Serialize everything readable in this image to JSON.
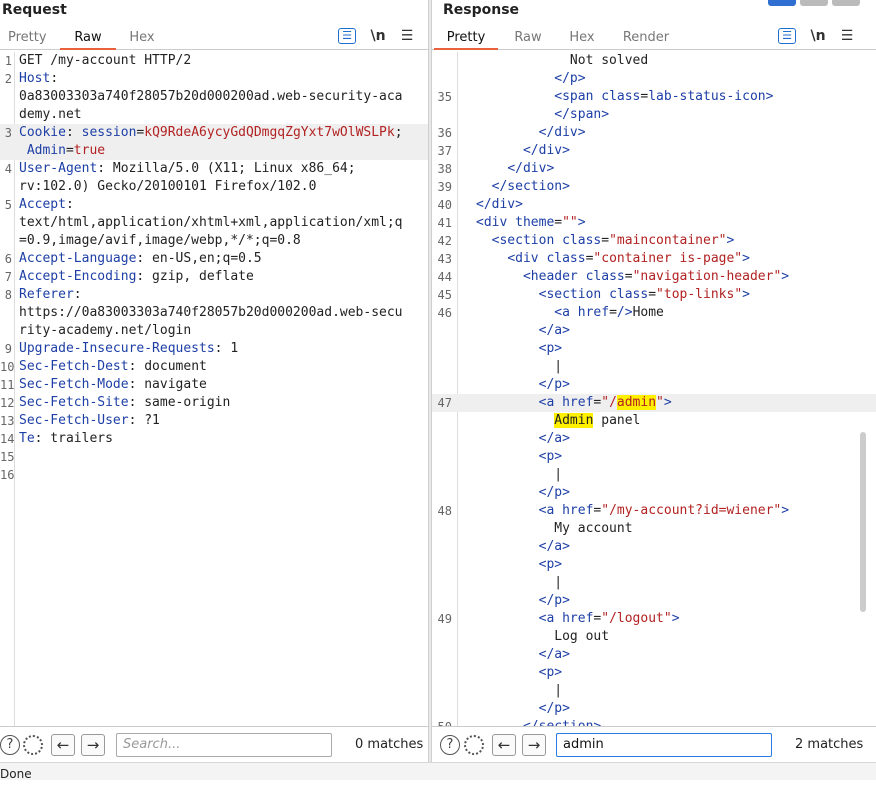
{
  "request": {
    "title": "Request",
    "tabs": [
      "Pretty",
      "Raw",
      "Hex"
    ],
    "active_tab": "Raw",
    "toolbar": {
      "wrap_icon": "word-wrap-icon",
      "newline_label": "\\n",
      "menu_icon": "hamburger-menu-icon"
    },
    "lines": [
      {
        "n": "1",
        "parts": [
          {
            "c": "",
            "t": "GET /my-account HTTP/2"
          }
        ]
      },
      {
        "n": "2",
        "parts": [
          {
            "c": "k",
            "t": "Host"
          },
          {
            "c": "",
            "t": ":"
          }
        ]
      },
      {
        "n": "",
        "parts": [
          {
            "c": "",
            "t": "0a83003303a740f28057b20d000200ad.web-security-aca"
          }
        ]
      },
      {
        "n": "",
        "parts": [
          {
            "c": "",
            "t": "demy.net"
          }
        ]
      },
      {
        "n": "3",
        "hl": true,
        "parts": [
          {
            "c": "k",
            "t": "Cookie"
          },
          {
            "c": "",
            "t": ": "
          },
          {
            "c": "k",
            "t": "session"
          },
          {
            "c": "",
            "t": "="
          },
          {
            "c": "v",
            "t": "kQ9RdeA6ycyGdQDmgqZgYxt7wOlWSLPk"
          },
          {
            "c": "",
            "t": ";"
          }
        ]
      },
      {
        "n": "",
        "hl": true,
        "parts": [
          {
            "c": "",
            "t": " "
          },
          {
            "c": "k",
            "t": "Admin"
          },
          {
            "c": "",
            "t": "="
          },
          {
            "c": "v",
            "t": "true"
          }
        ]
      },
      {
        "n": "4",
        "parts": [
          {
            "c": "k",
            "t": "User-Agent"
          },
          {
            "c": "",
            "t": ": Mozilla/5.0 (X11; Linux x86_64;"
          }
        ]
      },
      {
        "n": "",
        "parts": [
          {
            "c": "",
            "t": "rv:102.0) Gecko/20100101 Firefox/102.0"
          }
        ]
      },
      {
        "n": "5",
        "parts": [
          {
            "c": "k",
            "t": "Accept"
          },
          {
            "c": "",
            "t": ":"
          }
        ]
      },
      {
        "n": "",
        "parts": [
          {
            "c": "",
            "t": "text/html,application/xhtml+xml,application/xml;q"
          }
        ]
      },
      {
        "n": "",
        "parts": [
          {
            "c": "",
            "t": "=0.9,image/avif,image/webp,*/*;q=0.8"
          }
        ]
      },
      {
        "n": "6",
        "parts": [
          {
            "c": "k",
            "t": "Accept-Language"
          },
          {
            "c": "",
            "t": ": en-US,en;q=0.5"
          }
        ]
      },
      {
        "n": "7",
        "parts": [
          {
            "c": "k",
            "t": "Accept-Encoding"
          },
          {
            "c": "",
            "t": ": gzip, deflate"
          }
        ]
      },
      {
        "n": "8",
        "parts": [
          {
            "c": "k",
            "t": "Referer"
          },
          {
            "c": "",
            "t": ":"
          }
        ]
      },
      {
        "n": "",
        "parts": [
          {
            "c": "",
            "t": "https://0a83003303a740f28057b20d000200ad.web-secu"
          }
        ]
      },
      {
        "n": "",
        "parts": [
          {
            "c": "",
            "t": "rity-academy.net/login"
          }
        ]
      },
      {
        "n": "9",
        "parts": [
          {
            "c": "k",
            "t": "Upgrade-Insecure-Requests"
          },
          {
            "c": "",
            "t": ": 1"
          }
        ]
      },
      {
        "n": "10",
        "parts": [
          {
            "c": "k",
            "t": "Sec-Fetch-Dest"
          },
          {
            "c": "",
            "t": ": document"
          }
        ]
      },
      {
        "n": "11",
        "parts": [
          {
            "c": "k",
            "t": "Sec-Fetch-Mode"
          },
          {
            "c": "",
            "t": ": navigate"
          }
        ]
      },
      {
        "n": "12",
        "parts": [
          {
            "c": "k",
            "t": "Sec-Fetch-Site"
          },
          {
            "c": "",
            "t": ": same-origin"
          }
        ]
      },
      {
        "n": "13",
        "parts": [
          {
            "c": "k",
            "t": "Sec-Fetch-User"
          },
          {
            "c": "",
            "t": ": ?1"
          }
        ]
      },
      {
        "n": "14",
        "parts": [
          {
            "c": "k",
            "t": "Te"
          },
          {
            "c": "",
            "t": ": trailers"
          }
        ]
      },
      {
        "n": "15",
        "parts": []
      },
      {
        "n": "16",
        "parts": []
      }
    ],
    "search": {
      "placeholder": "Search...",
      "value": "",
      "matches": "0 matches"
    }
  },
  "response": {
    "title": "Response",
    "tabs": [
      "Pretty",
      "Raw",
      "Hex",
      "Render"
    ],
    "active_tab": "Pretty",
    "toolbar": {
      "wrap_icon": "word-wrap-icon",
      "newline_label": "\\n",
      "menu_icon": "hamburger-menu-icon"
    },
    "lines": [
      {
        "n": "",
        "parts": [
          {
            "c": "",
            "t": "            Not solved"
          }
        ]
      },
      {
        "n": "",
        "parts": [
          {
            "c": "",
            "t": "          "
          },
          {
            "c": "t",
            "t": "</p>"
          }
        ]
      },
      {
        "n": "35",
        "parts": [
          {
            "c": "",
            "t": "          "
          },
          {
            "c": "t",
            "t": "<span "
          },
          {
            "c": "a",
            "t": "class"
          },
          {
            "c": "",
            "t": "="
          },
          {
            "c": "t",
            "t": "lab-status-icon"
          },
          {
            "c": "t",
            "t": ">"
          }
        ]
      },
      {
        "n": "",
        "parts": [
          {
            "c": "",
            "t": "          "
          },
          {
            "c": "t",
            "t": "</span>"
          }
        ]
      },
      {
        "n": "36",
        "parts": [
          {
            "c": "",
            "t": "        "
          },
          {
            "c": "t",
            "t": "</div>"
          }
        ]
      },
      {
        "n": "37",
        "parts": [
          {
            "c": "",
            "t": "      "
          },
          {
            "c": "t",
            "t": "</div>"
          }
        ]
      },
      {
        "n": "38",
        "parts": [
          {
            "c": "",
            "t": "    "
          },
          {
            "c": "t",
            "t": "</div>"
          }
        ]
      },
      {
        "n": "39",
        "parts": [
          {
            "c": "",
            "t": "  "
          },
          {
            "c": "t",
            "t": "</section>"
          }
        ]
      },
      {
        "n": "40",
        "parts": [
          {
            "c": "t",
            "t": "</div>"
          }
        ]
      },
      {
        "n": "41",
        "parts": [
          {
            "c": "t",
            "t": "<div "
          },
          {
            "c": "a",
            "t": "theme"
          },
          {
            "c": "",
            "t": "="
          },
          {
            "c": "s",
            "t": "\"\""
          },
          {
            "c": "t",
            "t": ">"
          }
        ]
      },
      {
        "n": "42",
        "parts": [
          {
            "c": "",
            "t": "  "
          },
          {
            "c": "t",
            "t": "<section "
          },
          {
            "c": "a",
            "t": "class"
          },
          {
            "c": "",
            "t": "="
          },
          {
            "c": "s",
            "t": "\"maincontainer\""
          },
          {
            "c": "t",
            "t": ">"
          }
        ]
      },
      {
        "n": "43",
        "parts": [
          {
            "c": "",
            "t": "    "
          },
          {
            "c": "t",
            "t": "<div "
          },
          {
            "c": "a",
            "t": "class"
          },
          {
            "c": "",
            "t": "="
          },
          {
            "c": "s",
            "t": "\"container is-page\""
          },
          {
            "c": "t",
            "t": ">"
          }
        ]
      },
      {
        "n": "44",
        "parts": [
          {
            "c": "",
            "t": "      "
          },
          {
            "c": "t",
            "t": "<header "
          },
          {
            "c": "a",
            "t": "class"
          },
          {
            "c": "",
            "t": "="
          },
          {
            "c": "s",
            "t": "\"navigation-header\""
          },
          {
            "c": "t",
            "t": ">"
          }
        ]
      },
      {
        "n": "45",
        "parts": [
          {
            "c": "",
            "t": "        "
          },
          {
            "c": "t",
            "t": "<section "
          },
          {
            "c": "a",
            "t": "class"
          },
          {
            "c": "",
            "t": "="
          },
          {
            "c": "s",
            "t": "\"top-links\""
          },
          {
            "c": "t",
            "t": ">"
          }
        ]
      },
      {
        "n": "46",
        "parts": [
          {
            "c": "",
            "t": "          "
          },
          {
            "c": "t",
            "t": "<a "
          },
          {
            "c": "a",
            "t": "href"
          },
          {
            "c": "",
            "t": "="
          },
          {
            "c": "t",
            "t": "/>"
          },
          {
            "c": "",
            "t": "Home"
          }
        ]
      },
      {
        "n": "",
        "parts": [
          {
            "c": "",
            "t": "        "
          },
          {
            "c": "t",
            "t": "</a>"
          }
        ]
      },
      {
        "n": "",
        "parts": [
          {
            "c": "",
            "t": "        "
          },
          {
            "c": "t",
            "t": "<p>"
          }
        ]
      },
      {
        "n": "",
        "parts": [
          {
            "c": "",
            "t": "          |"
          }
        ]
      },
      {
        "n": "",
        "parts": [
          {
            "c": "",
            "t": "        "
          },
          {
            "c": "t",
            "t": "</p>"
          }
        ]
      },
      {
        "n": "47",
        "hl": true,
        "parts": [
          {
            "c": "",
            "t": "        "
          },
          {
            "c": "t",
            "t": "<a "
          },
          {
            "c": "a",
            "t": "href"
          },
          {
            "c": "",
            "t": "="
          },
          {
            "c": "s",
            "t": "\"/"
          },
          {
            "c": "s mark",
            "t": "admin"
          },
          {
            "c": "s",
            "t": "\""
          },
          {
            "c": "t",
            "t": ">"
          }
        ]
      },
      {
        "n": "",
        "parts": [
          {
            "c": "",
            "t": "          "
          },
          {
            "c": "mark",
            "t": "Admin"
          },
          {
            "c": "",
            "t": " panel"
          }
        ]
      },
      {
        "n": "",
        "parts": [
          {
            "c": "",
            "t": "        "
          },
          {
            "c": "t",
            "t": "</a>"
          }
        ]
      },
      {
        "n": "",
        "parts": [
          {
            "c": "",
            "t": "        "
          },
          {
            "c": "t",
            "t": "<p>"
          }
        ]
      },
      {
        "n": "",
        "parts": [
          {
            "c": "",
            "t": "          |"
          }
        ]
      },
      {
        "n": "",
        "parts": [
          {
            "c": "",
            "t": "        "
          },
          {
            "c": "t",
            "t": "</p>"
          }
        ]
      },
      {
        "n": "48",
        "parts": [
          {
            "c": "",
            "t": "        "
          },
          {
            "c": "t",
            "t": "<a "
          },
          {
            "c": "a",
            "t": "href"
          },
          {
            "c": "",
            "t": "="
          },
          {
            "c": "s",
            "t": "\"/my-account?id=wiener\""
          },
          {
            "c": "t",
            "t": ">"
          }
        ]
      },
      {
        "n": "",
        "parts": [
          {
            "c": "",
            "t": "          My account"
          }
        ]
      },
      {
        "n": "",
        "parts": [
          {
            "c": "",
            "t": "        "
          },
          {
            "c": "t",
            "t": "</a>"
          }
        ]
      },
      {
        "n": "",
        "parts": [
          {
            "c": "",
            "t": "        "
          },
          {
            "c": "t",
            "t": "<p>"
          }
        ]
      },
      {
        "n": "",
        "parts": [
          {
            "c": "",
            "t": "          |"
          }
        ]
      },
      {
        "n": "",
        "parts": [
          {
            "c": "",
            "t": "        "
          },
          {
            "c": "t",
            "t": "</p>"
          }
        ]
      },
      {
        "n": "49",
        "parts": [
          {
            "c": "",
            "t": "        "
          },
          {
            "c": "t",
            "t": "<a "
          },
          {
            "c": "a",
            "t": "href"
          },
          {
            "c": "",
            "t": "="
          },
          {
            "c": "s",
            "t": "\"/logout\""
          },
          {
            "c": "t",
            "t": ">"
          }
        ]
      },
      {
        "n": "",
        "parts": [
          {
            "c": "",
            "t": "          Log out"
          }
        ]
      },
      {
        "n": "",
        "parts": [
          {
            "c": "",
            "t": "        "
          },
          {
            "c": "t",
            "t": "</a>"
          }
        ]
      },
      {
        "n": "",
        "parts": [
          {
            "c": "",
            "t": "        "
          },
          {
            "c": "t",
            "t": "<p>"
          }
        ]
      },
      {
        "n": "",
        "parts": [
          {
            "c": "",
            "t": "          |"
          }
        ]
      },
      {
        "n": "",
        "parts": [
          {
            "c": "",
            "t": "        "
          },
          {
            "c": "t",
            "t": "</p>"
          }
        ]
      },
      {
        "n": "50",
        "parts": [
          {
            "c": "",
            "t": "      "
          },
          {
            "c": "t",
            "t": "</section>"
          }
        ]
      }
    ],
    "search": {
      "placeholder": "Search...",
      "value": "admin",
      "matches": "2 matches"
    }
  },
  "status": {
    "text": "Done"
  },
  "colors": {
    "accent": "#e8613c",
    "highlight": "#fff000",
    "keyword": "#1d3fa6",
    "value": "#b22222",
    "focus": "#2c7be5"
  }
}
